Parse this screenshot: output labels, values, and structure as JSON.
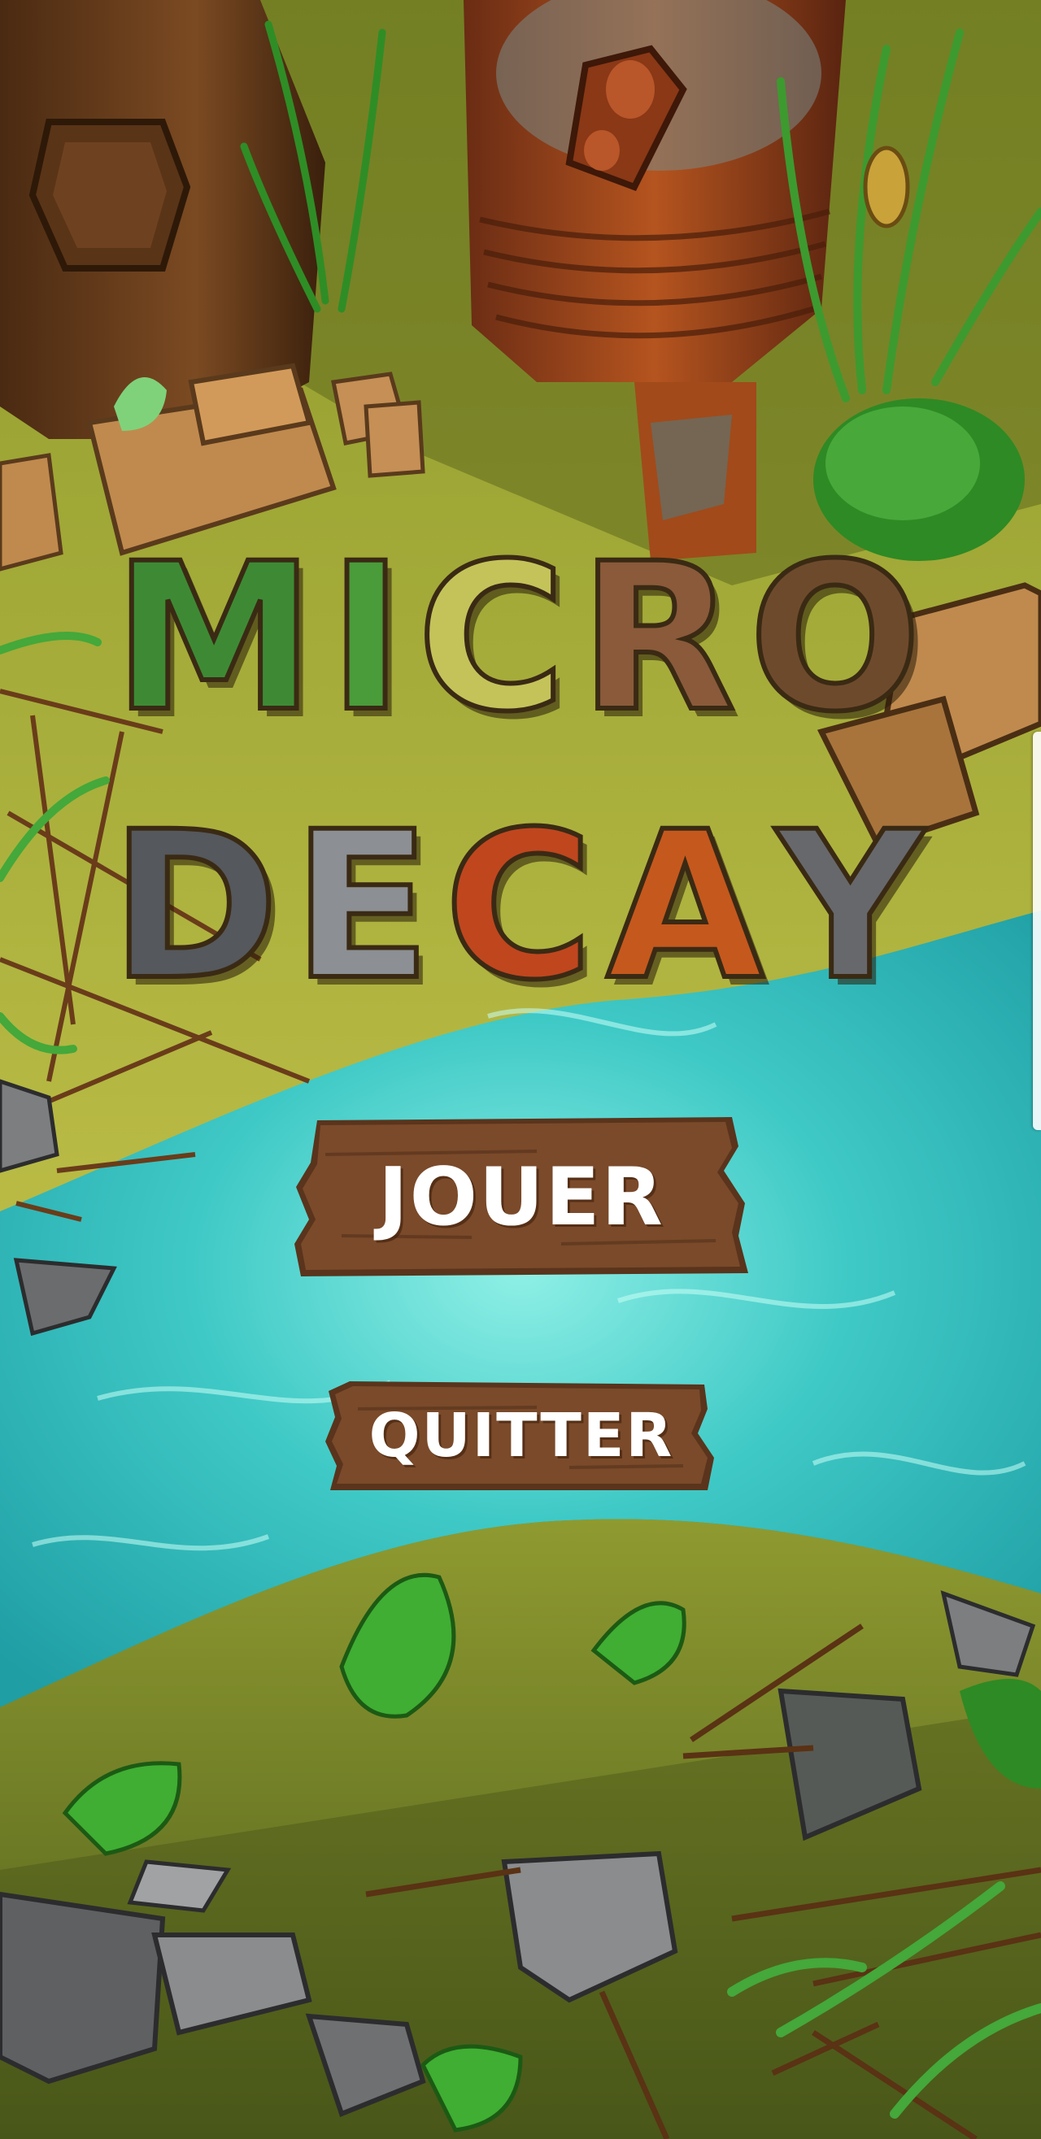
{
  "game": {
    "title_line1": "MICRO",
    "title_line2": "DECAY",
    "title_line1_letters": [
      "M",
      "I",
      "C",
      "R",
      "O"
    ],
    "title_line2_letters": [
      "D",
      "E",
      "C",
      "A",
      "Y"
    ],
    "title_line1_colors": [
      "#3e8a34",
      "#4a9b3a",
      "#c4c35a",
      "#8a5a3a",
      "#6e4a2c"
    ],
    "title_line2_colors": [
      "#55585c",
      "#8c8f93",
      "#c0461e",
      "#c5581d",
      "#67686b"
    ]
  },
  "menu": {
    "play_label": "JOUER",
    "quit_label": "QUITTER"
  },
  "colors": {
    "water": "#3fc9c6",
    "ground": "#8a9a2e",
    "plank": "#7a4a2a",
    "plank_dark": "#5a341c"
  },
  "icons": {
    "tree-stump": "tree-stump-icon",
    "rusty-barrel": "rusty-barrel-icon",
    "wooden-crate": "wooden-crate-icon",
    "leaf": "leaf-icon",
    "rock": "rock-icon",
    "twig": "twig-icon"
  }
}
